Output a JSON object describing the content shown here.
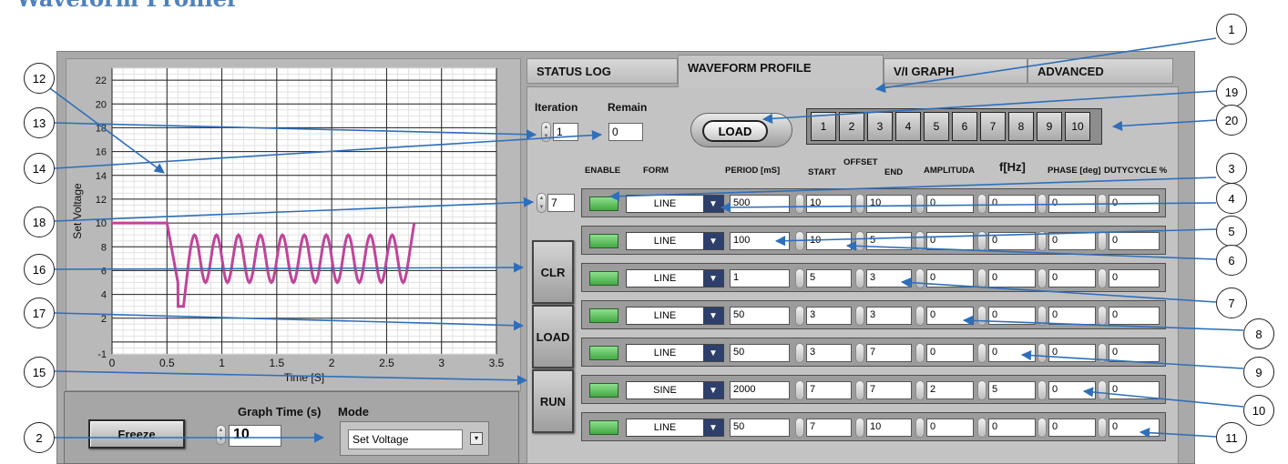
{
  "doc_title": "Waveform Profiler",
  "graph": {
    "y_label": "Set Voltage",
    "x_label": "Time [S]",
    "y_ticks": [
      "22",
      "20",
      "18",
      "16",
      "14",
      "12",
      "10",
      "8",
      "6",
      "4",
      "2",
      "-1"
    ],
    "x_ticks": [
      "0",
      "0.5",
      "1",
      "1.5",
      "2",
      "2.5",
      "3",
      "3.5"
    ],
    "line_color": "#c0449a"
  },
  "controls": {
    "freeze_label": "Freeze",
    "graph_time_label": "Graph Time (s)",
    "graph_time_value": "10",
    "mode_label": "Mode",
    "mode_value": "Set Voltage"
  },
  "tabs": [
    "STATUS LOG",
    "WAVEFORM PROFILE",
    "V/I GRAPH",
    "ADVANCED"
  ],
  "active_tab": "WAVEFORM PROFILE",
  "iteration": {
    "label": "Iteration",
    "value": "1"
  },
  "remain": {
    "label": "Remain",
    "value": "0"
  },
  "row_count": "7",
  "buttons": {
    "clr": "CLR",
    "load": "LOAD",
    "run": "RUN",
    "load_profile": "LOAD"
  },
  "profiles": [
    "1",
    "2",
    "3",
    "4",
    "5",
    "6",
    "7",
    "8",
    "9",
    "10"
  ],
  "columns": {
    "enable": "ENABLE",
    "form": "FORM",
    "period": "PERIOD [mS]",
    "start": "START",
    "offset": "OFFSET",
    "end": "END",
    "amplituda": "AMPLITUDA",
    "fhz": "f[Hz]",
    "phase": "PHASE [deg]",
    "duty": "DUTYCYCLE %"
  },
  "rows": [
    {
      "form": "LINE",
      "period": "500",
      "start": "10",
      "end": "10",
      "amp": "0",
      "f": "0",
      "phase": "0",
      "duty": "0"
    },
    {
      "form": "LINE",
      "period": "100",
      "start": "10",
      "end": "5",
      "amp": "0",
      "f": "0",
      "phase": "0",
      "duty": "0"
    },
    {
      "form": "LINE",
      "period": "1",
      "start": "5",
      "end": "3",
      "amp": "0",
      "f": "0",
      "phase": "0",
      "duty": "0"
    },
    {
      "form": "LINE",
      "period": "50",
      "start": "3",
      "end": "3",
      "amp": "0",
      "f": "0",
      "phase": "0",
      "duty": "0"
    },
    {
      "form": "LINE",
      "period": "50",
      "start": "3",
      "end": "7",
      "amp": "0",
      "f": "0",
      "phase": "0",
      "duty": "0"
    },
    {
      "form": "SINE",
      "period": "2000",
      "start": "7",
      "end": "7",
      "amp": "2",
      "f": "5",
      "phase": "0",
      "duty": "0"
    },
    {
      "form": "LINE",
      "period": "50",
      "start": "7",
      "end": "10",
      "amp": "0",
      "f": "0",
      "phase": "0",
      "duty": "0"
    }
  ],
  "callouts": [
    "1",
    "2",
    "3",
    "4",
    "5",
    "6",
    "7",
    "8",
    "9",
    "10",
    "11",
    "12",
    "13",
    "14",
    "15",
    "16",
    "17",
    "18",
    "19",
    "20"
  ],
  "colors": {
    "arrow": "#2e6fba",
    "led": "#5cc05c",
    "dropdown": "#2e3f6b"
  }
}
